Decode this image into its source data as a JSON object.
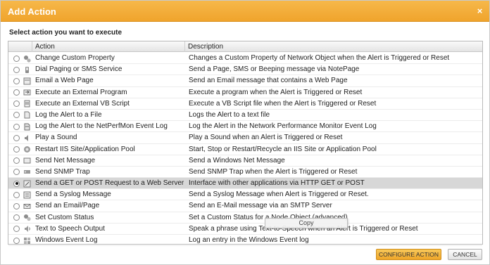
{
  "dialog": {
    "title": "Add Action",
    "prompt": "Select action you want to execute"
  },
  "table": {
    "headers": {
      "action": "Action",
      "description": "Description"
    },
    "rows": [
      {
        "action": "Change Custom Property",
        "description": "Changes a Custom Property of Network Object when the Alert is Triggered or Reset",
        "icon": "property-icon",
        "selected": false
      },
      {
        "action": "Dial Paging or SMS Service",
        "description": "Send a Page, SMS or Beeping message via NotePage",
        "icon": "phone-icon",
        "selected": false
      },
      {
        "action": "Email a Web Page",
        "description": "Send an Email message that contains a Web Page",
        "icon": "email-webpage-icon",
        "selected": false
      },
      {
        "action": "Execute an External Program",
        "description": "Execute a program when the Alert is Triggered or Reset",
        "icon": "program-icon",
        "selected": false
      },
      {
        "action": "Execute an External VB Script",
        "description": "Execute a VB Script file when the Alert is Triggered or Reset",
        "icon": "script-icon",
        "selected": false
      },
      {
        "action": "Log the Alert to a File",
        "description": "Logs the Alert to a text file",
        "icon": "file-icon",
        "selected": false
      },
      {
        "action": "Log the Alert to the NetPerfMon Event Log",
        "description": "Log the Alert in the Network Performance Monitor Event Log",
        "icon": "event-log-icon",
        "selected": false
      },
      {
        "action": "Play a Sound",
        "description": "Play a Sound when an Alert is Triggered or Reset",
        "icon": "sound-icon",
        "selected": false
      },
      {
        "action": "Restart IIS Site/Application Pool",
        "description": "Start, Stop or Restart/Recycle an IIS Site or Application Pool",
        "icon": "iis-icon",
        "selected": false
      },
      {
        "action": "Send Net Message",
        "description": "Send a Windows Net Message",
        "icon": "net-message-icon",
        "selected": false
      },
      {
        "action": "Send SNMP Trap",
        "description": "Send SNMP Trap when the Alert is Triggered or Reset",
        "icon": "snmp-icon",
        "selected": false
      },
      {
        "action": "Send a GET or POST Request to a Web Server",
        "description": "Interface with other applications via HTTP GET or POST",
        "icon": "http-icon",
        "selected": true
      },
      {
        "action": "Send a Syslog Message",
        "description": "Send a Syslog Message when Alert is Triggered or Reset.",
        "icon": "syslog-icon",
        "selected": false
      },
      {
        "action": "Send an Email/Page",
        "description": "Send an E-Mail message via an SMTP Server",
        "icon": "envelope-icon",
        "selected": false
      },
      {
        "action": "Set Custom Status",
        "description": "Set a Custom Status for a Node Object (advanced)",
        "icon": "status-icon",
        "selected": false
      },
      {
        "action": "Text to Speech Output",
        "description": "Speak a phrase using Text-to-Speech when an Alert is Triggered or Reset",
        "icon": "speech-icon",
        "selected": false
      },
      {
        "action": "Windows Event Log",
        "description": "Log an entry in the Windows Event log",
        "icon": "windows-log-icon",
        "selected": false
      }
    ]
  },
  "tooltip": {
    "text": "Copy"
  },
  "buttons": {
    "configure": "CONFIGURE ACTION",
    "cancel": "CANCEL"
  },
  "colors": {
    "title_bar": "#f0a42c",
    "configure_button": "#efa628",
    "selected_row": "#d7d7d7"
  }
}
